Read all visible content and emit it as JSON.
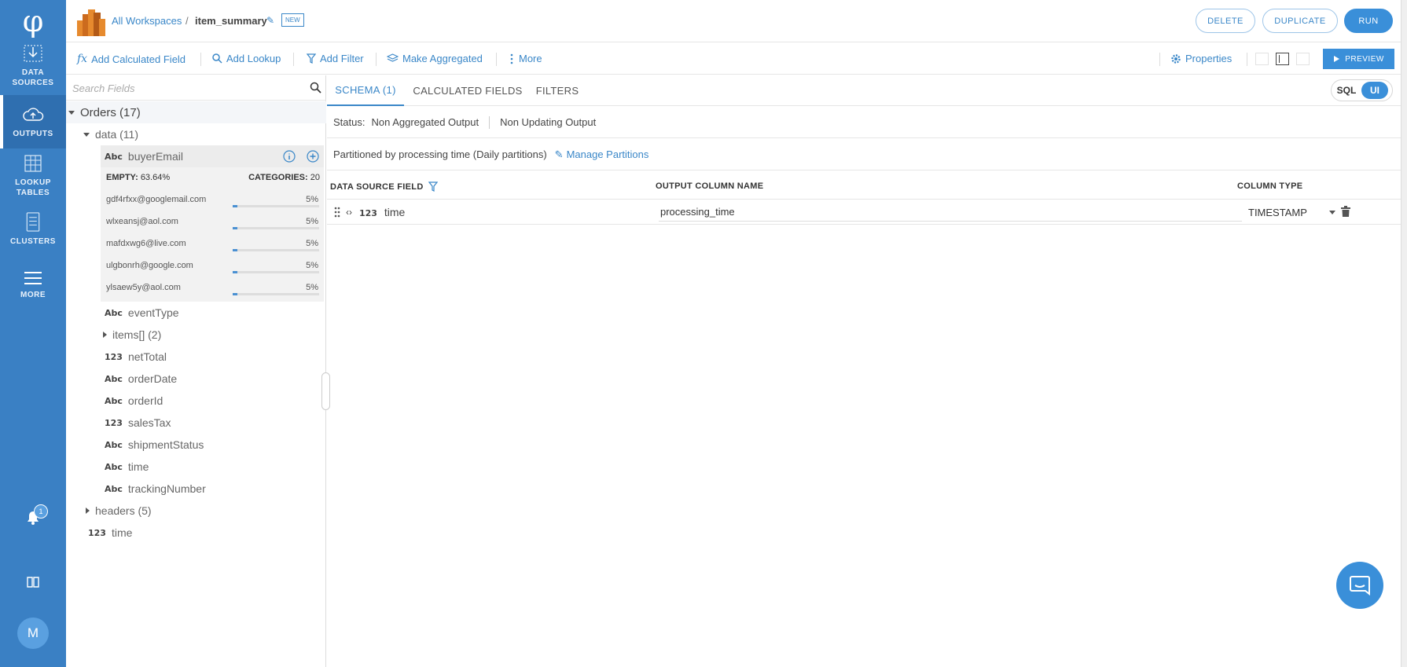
{
  "nav": {
    "logo": "φ",
    "items": [
      {
        "label_1": "DATA",
        "label_2": "SOURCES"
      },
      {
        "label_1": "OUTPUTS",
        "label_2": ""
      },
      {
        "label_1": "LOOKUP",
        "label_2": "TABLES"
      },
      {
        "label_1": "CLUSTERS",
        "label_2": ""
      },
      {
        "label_1": "MORE",
        "label_2": ""
      }
    ],
    "notification_count": "1",
    "avatar_initial": "M"
  },
  "header": {
    "breadcrumb_link": "All Workspaces",
    "breadcrumb_sep": "/",
    "title": "item_summary",
    "new_tag": "NEW",
    "delete_label": "DELETE",
    "duplicate_label": "DUPLICATE",
    "run_label": "RUN"
  },
  "toolbar": {
    "add_calculated_field": "Add Calculated Field",
    "add_lookup": "Add Lookup",
    "add_filter": "Add Filter",
    "make_aggregated": "Make Aggregated",
    "more": "More",
    "properties": "Properties",
    "preview": "PREVIEW"
  },
  "fields": {
    "search_placeholder": "Search Fields",
    "root": "Orders (17)",
    "data_group": "data (11)",
    "selected_field": {
      "type": "Abc",
      "name": "buyerEmail"
    },
    "stats": {
      "empty_label": "EMPTY:",
      "empty_value": "63.64%",
      "categories_label": "CATEGORIES:",
      "categories_value": "20",
      "rows": [
        {
          "email": "gdf4rfxx@googlemail.com",
          "pct": "5%",
          "fraction": 0.05
        },
        {
          "email": "wlxeansj@aol.com",
          "pct": "5%",
          "fraction": 0.05
        },
        {
          "email": "mafdxwg6@live.com",
          "pct": "5%",
          "fraction": 0.05
        },
        {
          "email": "ulgbonrh@google.com",
          "pct": "5%",
          "fraction": 0.05
        },
        {
          "email": "ylsaew5y@aol.com",
          "pct": "5%",
          "fraction": 0.05
        }
      ]
    },
    "items": [
      {
        "type": "Abc",
        "name": "eventType"
      },
      {
        "type": "",
        "name": "items[] (2)"
      },
      {
        "type": "123",
        "name": "netTotal"
      },
      {
        "type": "Abc",
        "name": "orderDate"
      },
      {
        "type": "Abc",
        "name": "orderId"
      },
      {
        "type": "123",
        "name": "salesTax"
      },
      {
        "type": "Abc",
        "name": "shipmentStatus"
      },
      {
        "type": "Abc",
        "name": "time"
      },
      {
        "type": "Abc",
        "name": "trackingNumber"
      }
    ],
    "headers_group": "headers (5)",
    "root_time": {
      "type": "123",
      "name": "time"
    }
  },
  "tabs": [
    "SCHEMA (1)",
    "CALCULATED FIELDS",
    "FILTERS"
  ],
  "mode_toggle": {
    "sql": "SQL",
    "ui": "UI"
  },
  "status": {
    "label": "Status:",
    "aggregation": "Non Aggregated Output",
    "updating": "Non Updating Output"
  },
  "partition": {
    "text": "Partitioned by processing time (Daily partitions)",
    "manage_link": "Manage Partitions"
  },
  "schema": {
    "col_source": "DATA SOURCE FIELD",
    "col_output": "OUTPUT COLUMN NAME",
    "col_type": "COLUMN TYPE",
    "row": {
      "source_type": "123",
      "source_name": "time",
      "output_name": "processing_time",
      "column_type": "TIMESTAMP"
    }
  },
  "colors": {
    "nav_bg": "#3a80c4",
    "accent": "#3a87c8",
    "primary_button": "#3a8fd9"
  }
}
